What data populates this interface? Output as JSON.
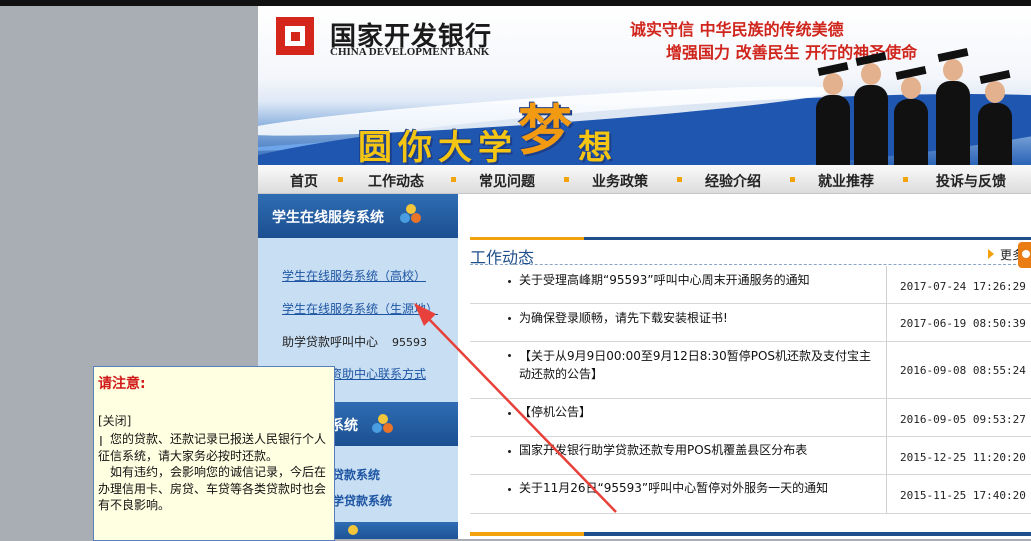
{
  "bank": {
    "name_cn": "国家开发银行",
    "name_en": "CHINA DEVELOPMENT BANK",
    "slogan_line1": "诚实守信  中华民族的传统美德",
    "slogan_line2": "增强国力 改善民生  开行的神圣使命",
    "banner_text_a": "圆你大学",
    "banner_text_b": "梦",
    "banner_text_c": "想"
  },
  "nav": {
    "items": [
      "首页",
      "工作动态",
      "常见问题",
      "业务政策",
      "经验介绍",
      "就业推荐",
      "投诉与反馈"
    ]
  },
  "sidebar": {
    "section1_title": "学生在线服务系统",
    "links": [
      "学生在线服务系统（高校）",
      "学生在线服务系统（生源地）"
    ],
    "hotline_label": "助学贷款呼叫中心",
    "hotline_number": "95593",
    "contact_link": "各分行及资助中心联系方式",
    "section2_title_partial": "系统",
    "section2_links": [
      "贷款系统",
      "学贷款系统"
    ]
  },
  "news": {
    "title": "工作动态",
    "more": "更多",
    "items": [
      {
        "title": "关于受理高峰期“95593”呼叫中心周末开通服务的通知",
        "date": "2017-07-24 17:26:29"
      },
      {
        "title": "为确保登录顺畅，请先下载安装根证书!",
        "date": "2017-06-19 08:50:39"
      },
      {
        "title": "【关于从9月9日00:00至9月12日8:30暂停POS机还款及支付宝主动还款的公告】",
        "date": "2016-09-08 08:55:24"
      },
      {
        "title": "【停机公告】",
        "date": "2016-09-05 09:53:27"
      },
      {
        "title": "国家开发银行助学贷款还款专用POS机覆盖县区分布表",
        "date": "2015-12-25 11:20:20"
      },
      {
        "title": "关于11月26日“95593”呼叫中心暂停对外服务一天的通知",
        "date": "2015-11-25 17:40:20"
      }
    ]
  },
  "popup": {
    "title": "请注意:",
    "close": "[关闭]",
    "para1": "您的贷款、还款记录已报送人民银行个人征信系统，请大家务必按时还款。",
    "para2": "如有违约，会影响您的诚信记录，今后在办理信用卡、房贷、车贷等各类贷款时也会有不良影响。"
  },
  "colors": {
    "brand_red": "#d5261b",
    "nav_blue": "#1f4f8a",
    "accent_orange": "#f3a20d",
    "annotation_arrow": "#e8403a"
  }
}
